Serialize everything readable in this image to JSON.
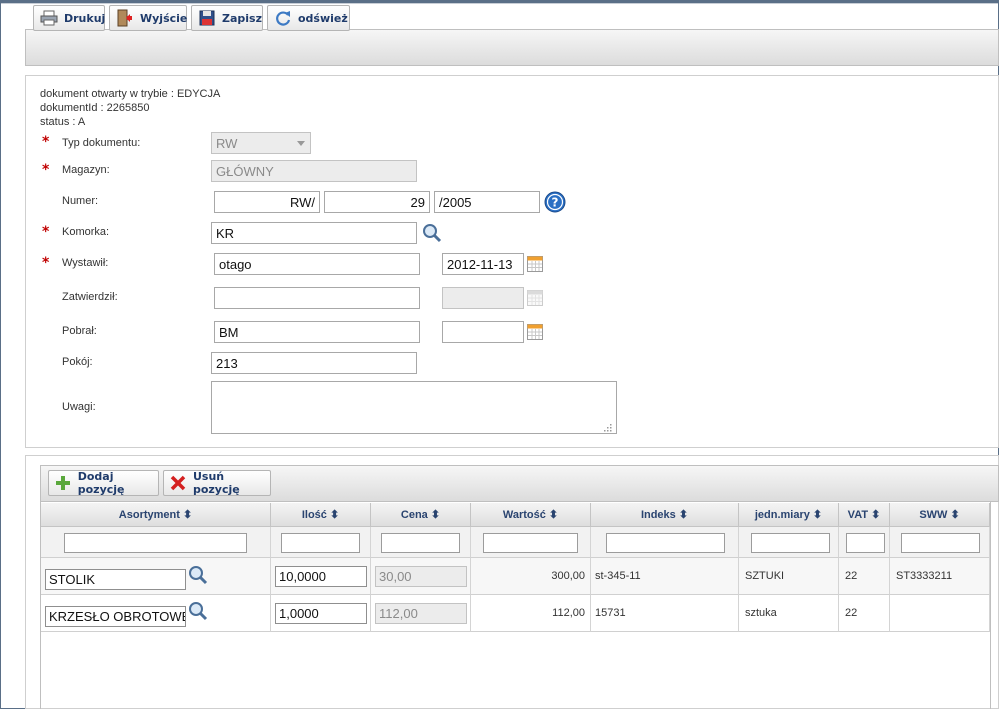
{
  "toolbar": {
    "print": "Drukuj",
    "exit": "Wyjście",
    "save": "Zapisz",
    "refresh": "odśwież"
  },
  "doc_info": {
    "mode": "dokument otwarty w trybie : EDYCJA",
    "doc_id": "dokumentId : 2265850",
    "status": "status : A"
  },
  "form": {
    "typ_label": "Typ dokumentu:",
    "typ_value": "RW",
    "magazyn_label": "Magazyn:",
    "magazyn_value": "GŁÓWNY",
    "numer_label": "Numer:",
    "numer_prefix": "RW/",
    "numer_number": "29",
    "numer_suffix": "/2005",
    "komorka_label": "Komorka:",
    "komorka_value": "KR",
    "wystawil_label": "Wystawił:",
    "wystawil_value": "otago",
    "wystawil_date": "2012-11-13",
    "zatwierdzil_label": "Zatwierdził:",
    "zatwierdzil_value": "",
    "zatwierdzil_date": "",
    "pobral_label": "Pobrał:",
    "pobral_value": "BM",
    "pobral_date": "",
    "pokoj_label": "Pokój:",
    "pokoj_value": "213",
    "uwagi_label": "Uwagi:",
    "uwagi_value": "",
    "required_mark": "*"
  },
  "grid_toolbar": {
    "add": "Dodaj pozycję",
    "remove": "Usuń pozycję"
  },
  "table": {
    "columns": [
      "Asortyment ⬍",
      "Ilość ⬍",
      "Cena ⬍",
      "Wartość ⬍",
      "Indeks ⬍",
      "jedn.miary ⬍",
      "VAT ⬍",
      "SWW ⬍"
    ],
    "rows": [
      {
        "asortyment": "STOLIK",
        "ilosc": "10,0000",
        "cena": "30,00",
        "wartosc": "300,00",
        "indeks": "st-345-11",
        "jm": "SZTUKI",
        "vat": "22",
        "sww": "ST3333211"
      },
      {
        "asortyment": "KRZESŁO OBROTOWE",
        "ilosc": "1,0000",
        "cena": "112,00",
        "wartosc": "112,00",
        "indeks": "15731",
        "jm": "sztuka",
        "vat": "22",
        "sww": ""
      }
    ]
  },
  "colors": {
    "toolbar_text": "#1f3b6b",
    "required": "#c00000",
    "help_icon": "#2a6fc4"
  }
}
